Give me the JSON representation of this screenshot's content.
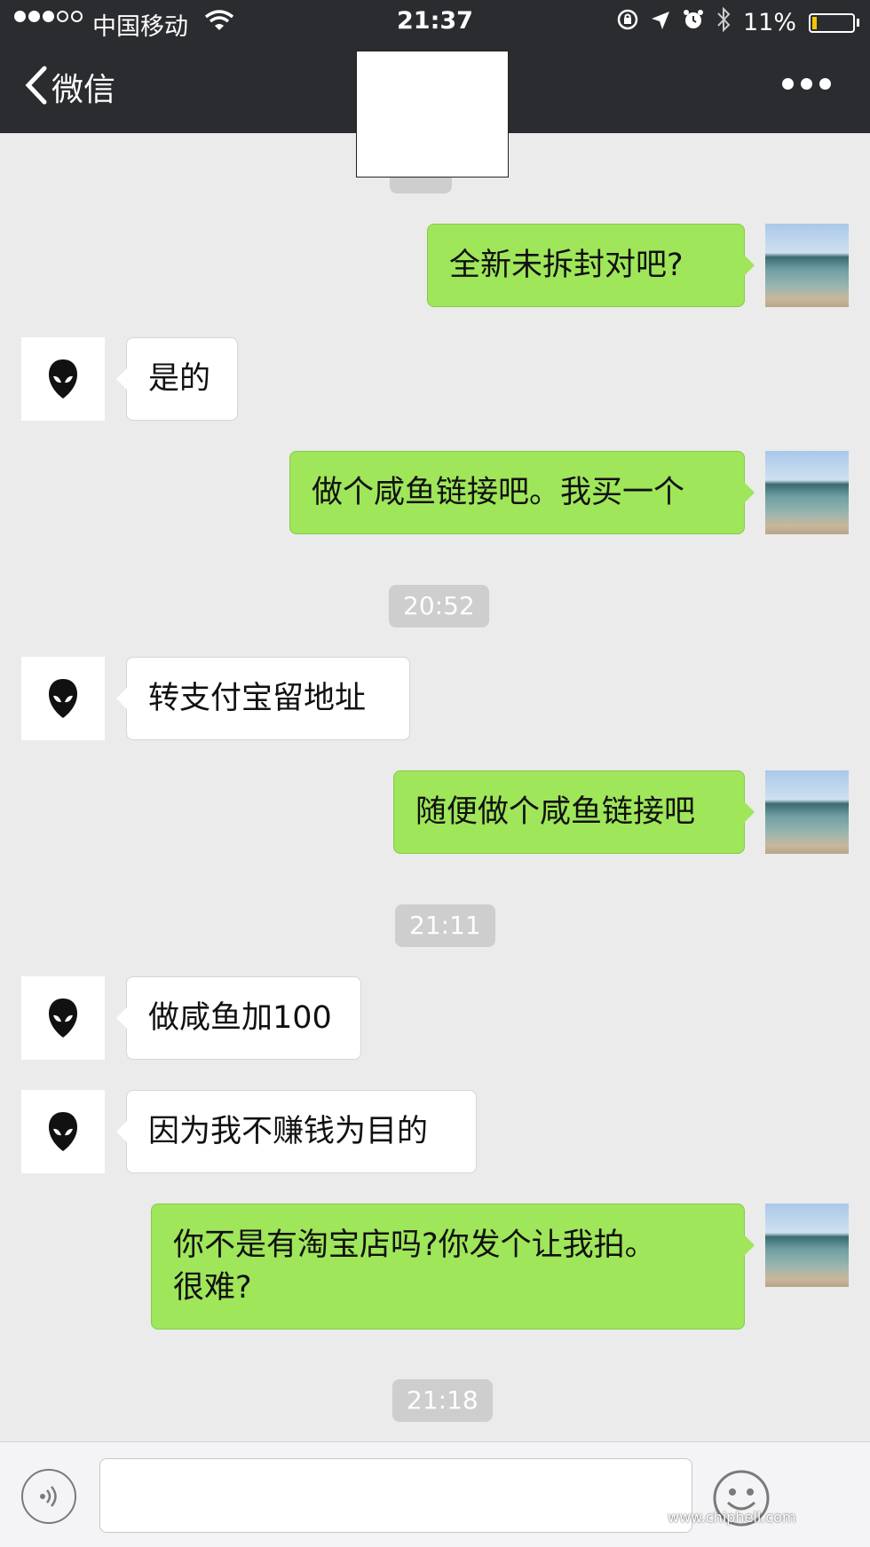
{
  "status_bar": {
    "carrier": "中国移动",
    "time": "21:37",
    "battery": "11%",
    "battery_level": 0.11
  },
  "nav": {
    "back_label": "微信"
  },
  "messages": [
    {
      "side": "right",
      "text": "全新未拆封对吧?"
    },
    {
      "side": "left",
      "text": "是的"
    },
    {
      "side": "right",
      "text": "做个咸鱼链接吧。我买一个"
    },
    {
      "time": "20:52"
    },
    {
      "side": "left",
      "text": "转支付宝留地址"
    },
    {
      "side": "right",
      "text": "随便做个咸鱼链接吧"
    },
    {
      "time": "21:11"
    },
    {
      "side": "left",
      "text": "做咸鱼加100"
    },
    {
      "side": "left",
      "text": "因为我不赚钱为目的"
    },
    {
      "side": "right",
      "text": "你不是有淘宝店吗?你发个让我拍。\n很难?"
    },
    {
      "time": "21:18"
    }
  ],
  "watermark": "www.chiphell.com"
}
